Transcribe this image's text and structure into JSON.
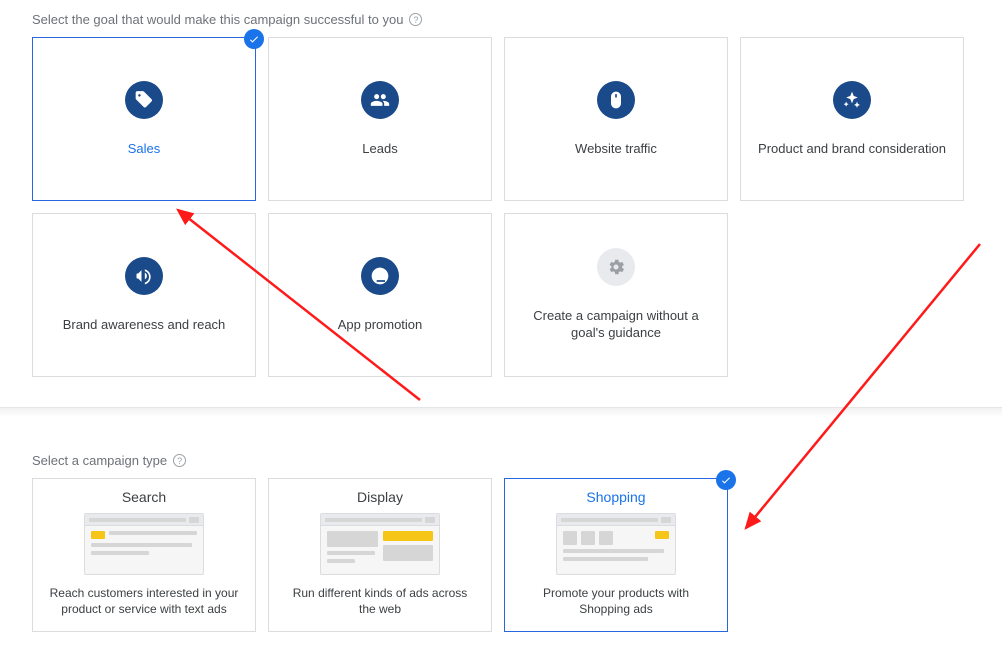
{
  "goals": {
    "section_label": "Select the goal that would make this campaign successful to you",
    "items": [
      {
        "label": "Sales",
        "icon": "tag-icon",
        "selected": true
      },
      {
        "label": "Leads",
        "icon": "people-icon",
        "selected": false
      },
      {
        "label": "Website traffic",
        "icon": "mouse-icon",
        "selected": false
      },
      {
        "label": "Product and brand consideration",
        "icon": "sparkle-icon",
        "selected": false
      },
      {
        "label": "Brand awareness and reach",
        "icon": "megaphone-icon",
        "selected": false
      },
      {
        "label": "App promotion",
        "icon": "download-icon",
        "selected": false
      },
      {
        "label": "Create a campaign without a goal's guidance",
        "icon": "gear-icon",
        "selected": false,
        "muted": true
      }
    ]
  },
  "types": {
    "section_label": "Select a campaign type",
    "items": [
      {
        "title": "Search",
        "desc": "Reach customers interested in your product or service with text ads",
        "selected": false
      },
      {
        "title": "Display",
        "desc": "Run different kinds of ads across the web",
        "selected": false
      },
      {
        "title": "Shopping",
        "desc": "Promote your products with Shopping ads",
        "selected": true
      }
    ]
  }
}
